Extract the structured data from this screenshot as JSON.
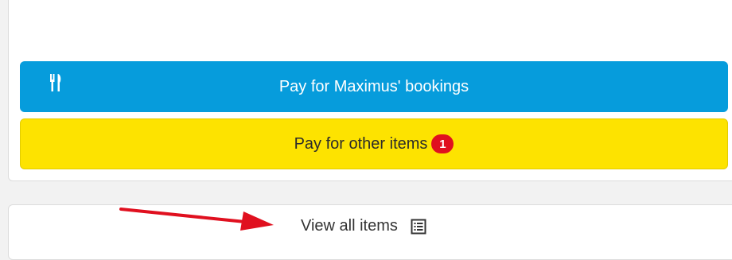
{
  "buttons": {
    "maximus_label": "Pay for Maximus' bookings",
    "maximus_icon": "restaurant-utensils-icon",
    "maximus_color": "#069cdc",
    "other_label": "Pay for other items",
    "other_badge": "1",
    "other_color": "#fde300",
    "badge_color": "#e0101f"
  },
  "footer": {
    "view_all_label": "View all items",
    "view_all_icon": "list-icon"
  },
  "annotation": {
    "arrow_icon": "red-arrow-icon",
    "arrow_color": "#e0101f"
  }
}
